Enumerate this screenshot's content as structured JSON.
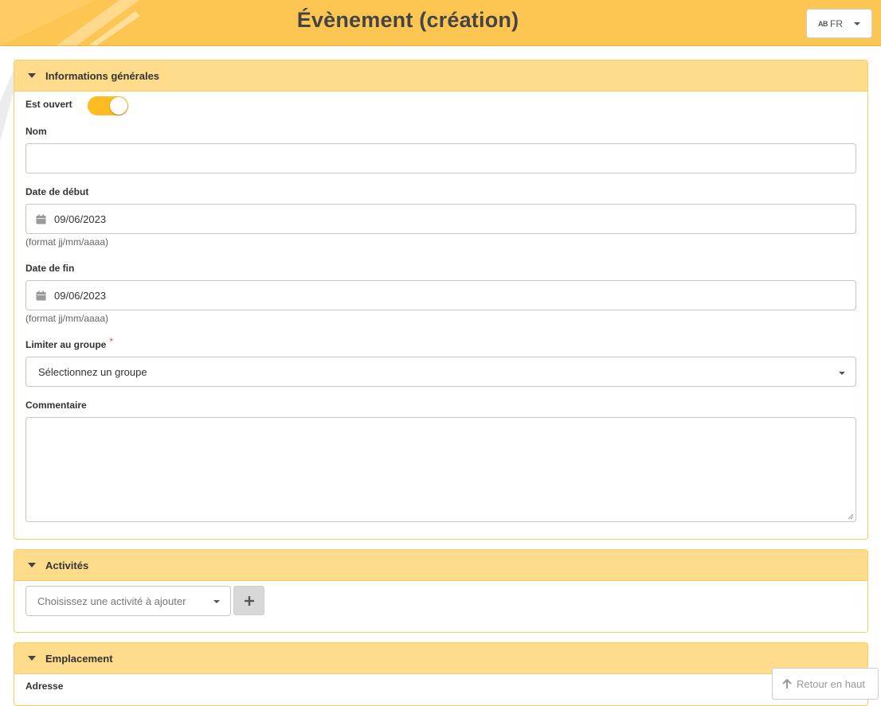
{
  "header": {
    "title": "Évènement (création)",
    "language": {
      "code": "FR",
      "icon": "language-icon"
    }
  },
  "sections": {
    "general": {
      "title": "Informations générales",
      "is_open_label": "Est ouvert",
      "is_open_value": true,
      "name_label": "Nom",
      "name_value": "",
      "start_label": "Date de début",
      "start_value": "09/06/2023",
      "start_hint": "(format jj/mm/aaaa)",
      "end_label": "Date de fin",
      "end_value": "09/06/2023",
      "end_hint": "(format jj/mm/aaaa)",
      "group_label": "Limiter au groupe",
      "group_required_mark": "*",
      "group_placeholder": "Sélectionnez un groupe",
      "comment_label": "Commentaire",
      "comment_value": ""
    },
    "activities": {
      "title": "Activités",
      "select_placeholder": "Choisissez une activité à ajouter",
      "add_icon": "plus-icon"
    },
    "location": {
      "title": "Emplacement",
      "address_label": "Adresse"
    }
  },
  "back_to_top": {
    "label": "Retour en haut",
    "icon": "arrow-up-icon"
  },
  "colors": {
    "header": "#fdc552",
    "panel_header": "#ffdb8c",
    "panel_border": "#f8cd61",
    "toggle_on": "#ffbb22",
    "required": "#d9534f"
  }
}
